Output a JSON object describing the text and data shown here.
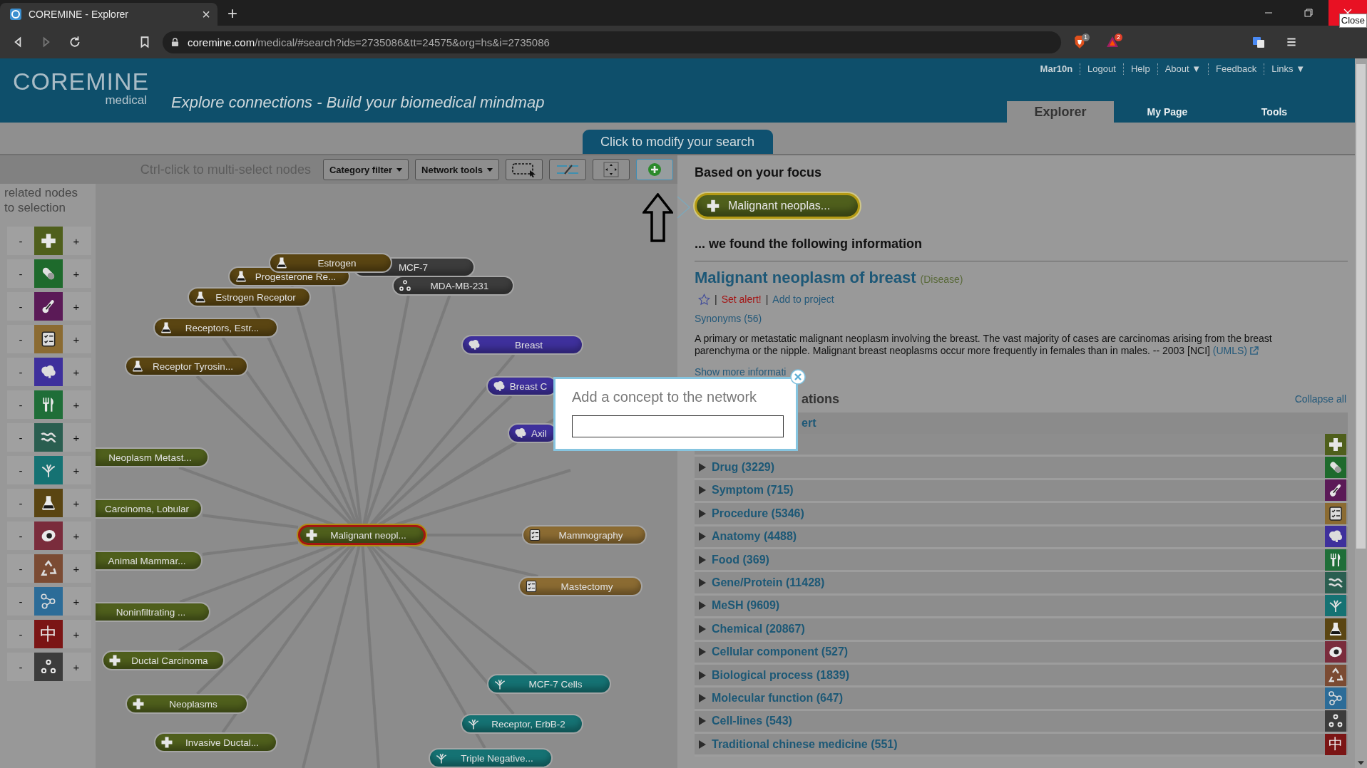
{
  "browser": {
    "tab_title": "COREMINE - Explorer",
    "tab_close": "×",
    "new_tab": "+",
    "url_host": "coremine.com",
    "url_path": "/medical/#search?ids=2735086&tt=24575&org=hs&i=2735086",
    "badges": [
      "1",
      "2"
    ],
    "tooltip": "Close"
  },
  "header": {
    "logo": "COREMINE",
    "logo_sub": "medical",
    "tagline": "Explore connections - Build your biomedical mindmap",
    "user": "Mar10n",
    "links": [
      "Logout",
      "Help",
      "About ▼",
      "Feedback",
      "Links ▼"
    ],
    "tabs": [
      {
        "label": "Explorer",
        "selected": true
      },
      {
        "label": "My Page",
        "selected": false
      },
      {
        "label": "Tools",
        "selected": false
      }
    ]
  },
  "search_tab": "Click to modify your search",
  "toolbar": {
    "hint": "Ctrl-click to multi-select nodes",
    "dropdowns": [
      "Category filter",
      "Network tools"
    ],
    "tools": [
      {
        "kind": "select",
        "selected": false
      },
      {
        "kind": "layout",
        "selected": false
      },
      {
        "kind": "fit",
        "selected": false
      },
      {
        "kind": "add",
        "selected": true
      }
    ]
  },
  "sidebar": {
    "title": "related nodes to selection",
    "categories": [
      {
        "kind": "disease",
        "color": "#4f5f1c",
        "minus": "-",
        "plus": "+"
      },
      {
        "kind": "drug",
        "color": "#1e6a2c",
        "minus": "-",
        "plus": "+"
      },
      {
        "kind": "symptom",
        "color": "#5b1a57",
        "minus": "-",
        "plus": "+"
      },
      {
        "kind": "procedure",
        "color": "#8b6b32",
        "minus": "-",
        "plus": "+"
      },
      {
        "kind": "anatomy",
        "color": "#3e309c",
        "minus": "-",
        "plus": "+"
      },
      {
        "kind": "food",
        "color": "#1f6e38",
        "minus": "-",
        "plus": "+"
      },
      {
        "kind": "gene",
        "color": "#2a5e50",
        "minus": "-",
        "plus": "+"
      },
      {
        "kind": "mesh",
        "color": "#157273",
        "minus": "-",
        "plus": "+"
      },
      {
        "kind": "chemical",
        "color": "#5a4512",
        "minus": "-",
        "plus": "+"
      },
      {
        "kind": "cellular",
        "color": "#7a2c3c",
        "minus": "-",
        "plus": "+"
      },
      {
        "kind": "bioprocess",
        "color": "#7b4b33",
        "minus": "-",
        "plus": "+"
      },
      {
        "kind": "molecular",
        "color": "#2c6c98",
        "minus": "-",
        "plus": "+"
      },
      {
        "kind": "tcm",
        "color": "#7b1515",
        "glyph": "中",
        "minus": "-",
        "plus": "+"
      },
      {
        "kind": "cellline",
        "color": "#3c3c3c",
        "minus": "-",
        "plus": "+"
      }
    ]
  },
  "network": {
    "nodes": [
      {
        "label": "MCF-7",
        "kind": "cellline",
        "selected": false
      },
      {
        "label": "Progesterone Re...",
        "kind": "chemical",
        "selected": false
      },
      {
        "label": "Estrogen",
        "kind": "chemical",
        "selected": false
      },
      {
        "label": "MDA-MB-231",
        "kind": "cellline",
        "selected": false
      },
      {
        "label": "Estrogen Receptor",
        "kind": "chemical",
        "selected": false
      },
      {
        "label": "Receptors, Estr...",
        "kind": "chemical",
        "selected": false
      },
      {
        "label": "Receptor Tyrosin...",
        "kind": "chemical",
        "selected": false
      },
      {
        "label": "Breast",
        "kind": "anatomy",
        "selected": false
      },
      {
        "label": "Breast C",
        "kind": "anatomy",
        "selected": false
      },
      {
        "label": "Axil",
        "kind": "anatomy",
        "selected": false
      },
      {
        "label": "Neoplasm Metast...",
        "kind": "disease",
        "selected": false
      },
      {
        "label": "Carcinoma, Lobular",
        "kind": "disease",
        "selected": false
      },
      {
        "label": "Malignant neopl...",
        "kind": "disease",
        "selected": true
      },
      {
        "label": "Mammography",
        "kind": "procedure",
        "selected": false
      },
      {
        "label": "Animal Mammar...",
        "kind": "disease",
        "selected": false
      },
      {
        "label": "Mastectomy",
        "kind": "procedure",
        "selected": false
      },
      {
        "label": "Noninfiltrating ...",
        "kind": "disease",
        "selected": false
      },
      {
        "label": "Ductal Carcinoma",
        "kind": "disease",
        "selected": false
      },
      {
        "label": "MCF-7 Cells",
        "kind": "mesh",
        "selected": false
      },
      {
        "label": "Neoplasms",
        "kind": "disease",
        "selected": false
      },
      {
        "label": "Receptor, ErbB-2",
        "kind": "mesh",
        "selected": false
      },
      {
        "label": "Invasive Ductal...",
        "kind": "disease",
        "selected": false
      },
      {
        "label": "Triple Negative...",
        "kind": "mesh",
        "selected": false
      }
    ]
  },
  "focus": {
    "title": "Based on your focus",
    "node": {
      "label": "Malignant neoplas...",
      "kind": "disease"
    },
    "found": "... we found the following information",
    "concept": {
      "name": "Malignant neoplasm of breast",
      "type": "(Disease)",
      "starred": false,
      "separators": [
        "|",
        "|"
      ],
      "alert": "Set alert!",
      "project": "Add to project",
      "synonyms": "Synonyms (56)",
      "description": "A primary or metastatic malignant neoplasm involving the breast. The vast majority of cases are carcinomas arising from the breast parenchyma or the nipple. Malignant breast neoplasms occur more frequently in females than in males. -- 2003 [NCI]",
      "source": "(UMLS)",
      "more": "Show more informati"
    }
  },
  "associations": {
    "heading": "ations",
    "collapse": "Collapse all",
    "group": "ert",
    "categories": [
      {
        "kind": "disease"
      },
      {
        "kind": "drug",
        "label": "Drug (3229)",
        "expanded": false
      },
      {
        "kind": "symptom",
        "label": "Symptom (715)",
        "expanded": false
      },
      {
        "kind": "procedure",
        "label": "Procedure (5346)",
        "expanded": false
      },
      {
        "kind": "anatomy",
        "label": "Anatomy (4488)",
        "expanded": false
      },
      {
        "kind": "food",
        "label": "Food (369)",
        "expanded": false
      },
      {
        "kind": "gene",
        "label": "Gene/Protein (11428)",
        "expanded": false
      },
      {
        "kind": "mesh",
        "label": "MeSH (9609)",
        "expanded": false
      },
      {
        "kind": "chemical",
        "label": "Chemical (20867)",
        "expanded": false
      },
      {
        "kind": "cellular",
        "label": "Cellular component (527)",
        "expanded": false
      },
      {
        "kind": "bioprocess",
        "label": "Biological process (1839)",
        "expanded": false
      },
      {
        "kind": "molecular",
        "label": "Molecular function (647)",
        "expanded": false
      },
      {
        "kind": "cellline",
        "label": "Cell-lines (543)",
        "expanded": false
      },
      {
        "kind": "tcm",
        "label": "Traditional chinese medicine (551)",
        "glyph": "中",
        "expanded": false
      }
    ]
  },
  "dialog": {
    "title": "Add a concept to the network"
  }
}
